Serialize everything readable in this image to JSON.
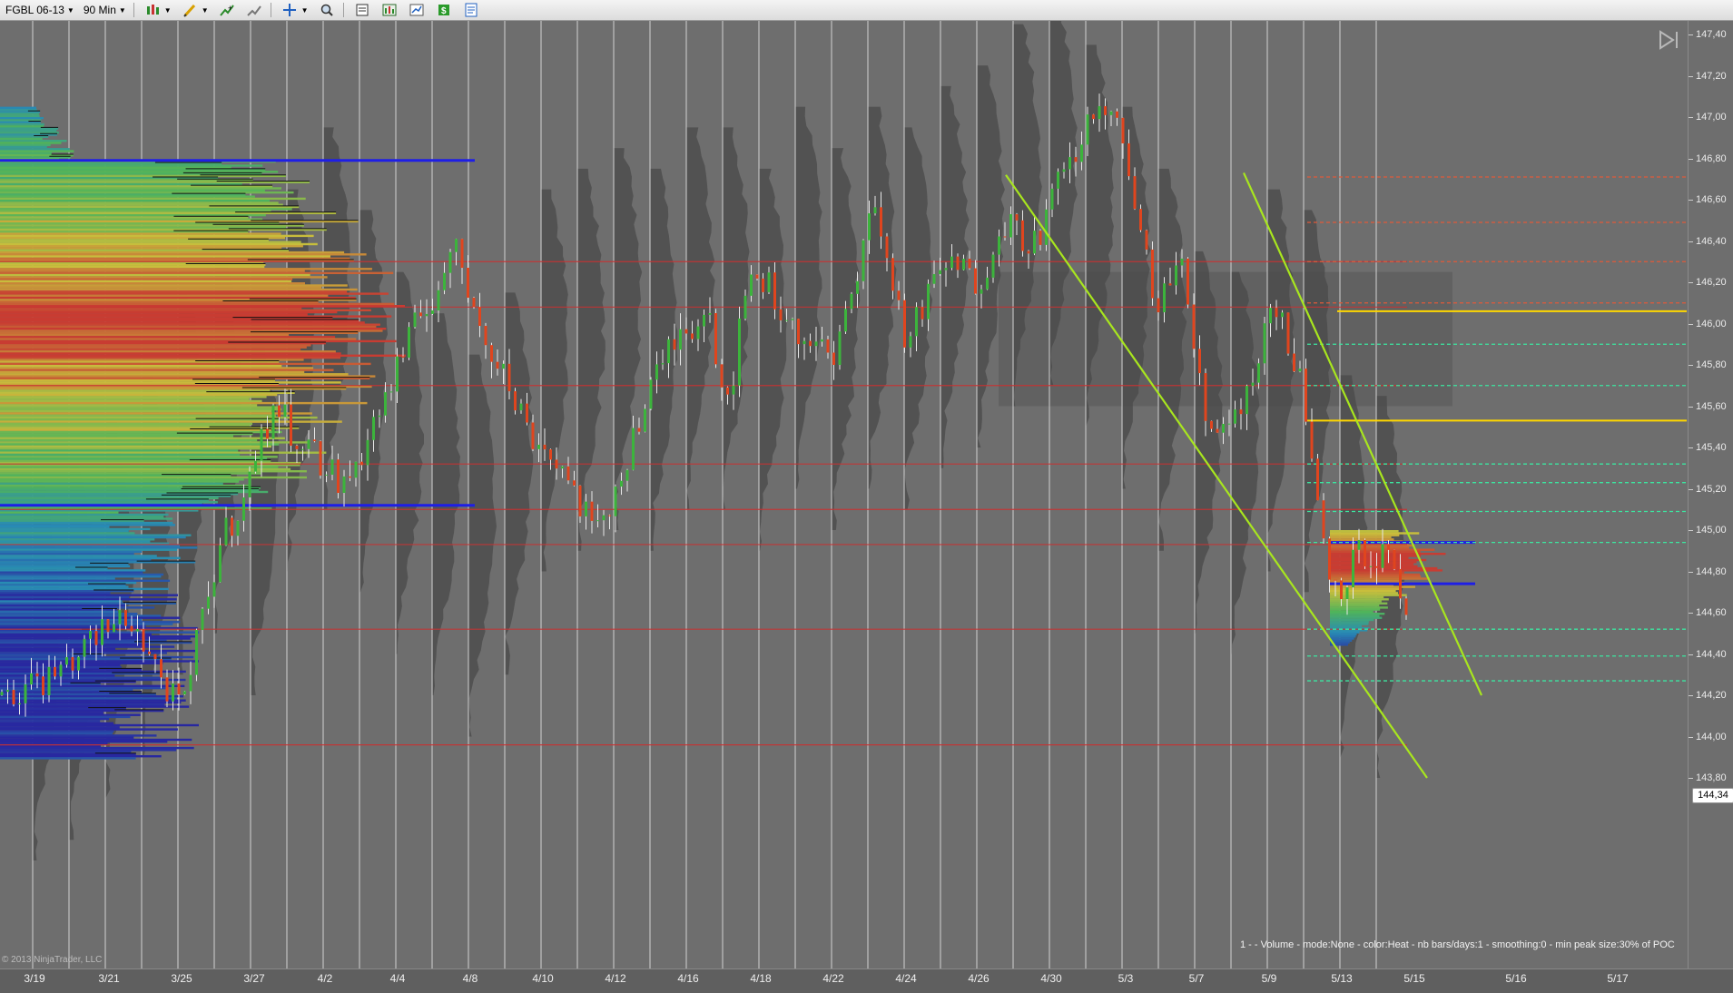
{
  "toolbar": {
    "instrument": "FGBL 06-13",
    "interval": "90 Min",
    "icons": [
      "bar-type-icon",
      "drawing-pencil-icon",
      "add-indicator-icon",
      "strategy-icon",
      "crosshair-icon",
      "zoom-icon",
      "data-box-icon",
      "chart-trader-icon",
      "properties-icon",
      "strategy-s-icon",
      "template-icon"
    ]
  },
  "chart_data": {
    "type": "market-profile-candlestick",
    "instrument": "FGBL 06-13",
    "y_axis_ticks": [
      "147,40",
      "147,20",
      "147,00",
      "146,80",
      "146,60",
      "146,40",
      "146,20",
      "146,00",
      "145,80",
      "145,60",
      "145,40",
      "145,20",
      "145,00",
      "144,80",
      "144,60",
      "144,40",
      "144,20",
      "144,00",
      "143,80"
    ],
    "ylim": [
      143.7,
      147.45
    ],
    "x_axis_ticks": [
      "3/19",
      "3/21",
      "3/25",
      "3/27",
      "4/2",
      "4/4",
      "4/8",
      "4/10",
      "4/12",
      "4/16",
      "4/18",
      "4/22",
      "4/24",
      "4/26",
      "4/30",
      "5/3",
      "5/7",
      "5/9",
      "5/13",
      "5/15",
      "5/16",
      "5/17"
    ],
    "last_price": "144,34",
    "colors": {
      "background": "#6e6e6e",
      "profile_shadow": "#4a4a4a",
      "session_separator": "#c8c8c8",
      "candle_up": "#3cb43c",
      "candle_down": "#e0451e",
      "trendline": "#a8e61e",
      "poc_line": "#ffd700",
      "value_area_line": "#1e1ee6",
      "level_line": "#c83232",
      "dashed_level": "#3ce6a0"
    },
    "horizontal_levels": [
      146.3,
      146.08,
      145.7,
      145.32,
      145.1,
      144.93,
      144.52,
      143.96
    ],
    "poc_levels": [
      146.06,
      145.53
    ],
    "value_area_high": [
      146.79,
      144.94
    ],
    "value_area_low": [
      145.12,
      144.74
    ],
    "dashed_levels": [
      146.71,
      146.49,
      146.3,
      146.1,
      145.9,
      145.7,
      145.32,
      145.23,
      145.09,
      144.94,
      144.52,
      144.39,
      144.27
    ]
  },
  "info_text": "1 - - Volume - mode:None - color:Heat - nb bars/days:1 - smoothing:0 - min peak size:30% of POC",
  "copyright": "© 2013 NinjaTrader, LLC"
}
